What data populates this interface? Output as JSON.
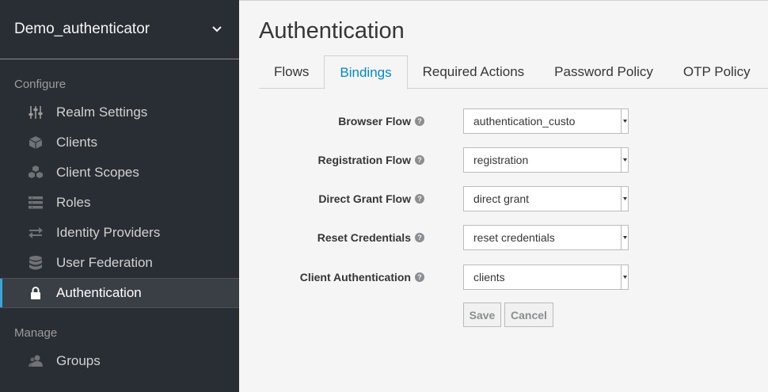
{
  "sidebar": {
    "realm_name": "Demo_authenticator",
    "configure_title": "Configure",
    "manage_title": "Manage",
    "configure_items": [
      {
        "label": "Realm Settings",
        "icon": "sliders-icon"
      },
      {
        "label": "Clients",
        "icon": "cube-icon"
      },
      {
        "label": "Client Scopes",
        "icon": "cubes-icon"
      },
      {
        "label": "Roles",
        "icon": "list-icon"
      },
      {
        "label": "Identity Providers",
        "icon": "exchange-icon"
      },
      {
        "label": "User Federation",
        "icon": "database-icon"
      },
      {
        "label": "Authentication",
        "icon": "lock-icon",
        "active": true
      }
    ],
    "manage_items": [
      {
        "label": "Groups",
        "icon": "users-icon"
      }
    ]
  },
  "main": {
    "title": "Authentication",
    "tabs": [
      {
        "label": "Flows"
      },
      {
        "label": "Bindings",
        "active": true
      },
      {
        "label": "Required Actions"
      },
      {
        "label": "Password Policy"
      },
      {
        "label": "OTP Policy"
      }
    ],
    "form": {
      "browser_flow": {
        "label": "Browser Flow",
        "value": "authentication_custo"
      },
      "registration_flow": {
        "label": "Registration Flow",
        "value": "registration"
      },
      "direct_grant_flow": {
        "label": "Direct Grant Flow",
        "value": "direct grant"
      },
      "reset_credentials": {
        "label": "Reset Credentials",
        "value": "reset credentials"
      },
      "client_authentication": {
        "label": "Client Authentication",
        "value": "clients"
      }
    },
    "buttons": {
      "save": "Save",
      "cancel": "Cancel"
    }
  },
  "colors": {
    "sidebar_bg": "#292e34",
    "active_accent": "#39a5dc",
    "link_blue": "#0088ce"
  }
}
